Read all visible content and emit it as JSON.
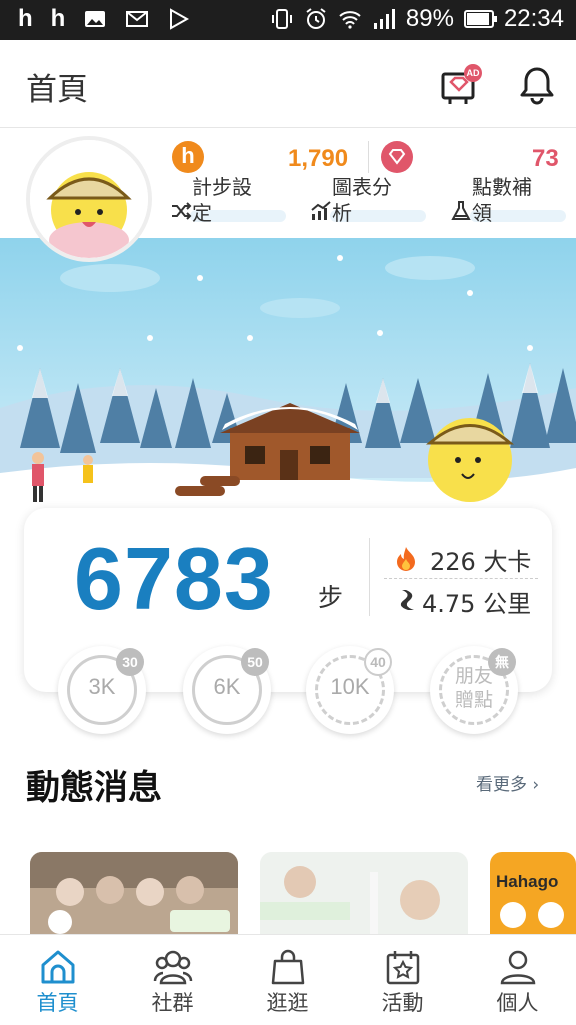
{
  "status_bar": {
    "battery": "89%",
    "time": "22:34"
  },
  "header": {
    "title": "首頁",
    "gift_badge": "AD"
  },
  "points": {
    "h_points": "1,790",
    "gem_points": "73"
  },
  "quick_actions": [
    {
      "label_line1": "計步設",
      "label_line2": "定",
      "icon": "shuffle-icon"
    },
    {
      "label_line1": "圖表分",
      "label_line2": "析",
      "icon": "chart-icon"
    },
    {
      "label_line1": "點數補",
      "label_line2": "領",
      "icon": "flask-icon"
    }
  ],
  "steps": {
    "value": "6783",
    "unit": "步",
    "calories": "226 大卡",
    "distance": "4.75 公里"
  },
  "milestones": [
    {
      "label": "3K",
      "badge": "30"
    },
    {
      "label": "6K",
      "badge": "50"
    },
    {
      "label": "10K",
      "badge": "40"
    },
    {
      "label_line1": "朋友",
      "label_line2": "贈點",
      "badge": "無"
    }
  ],
  "news": {
    "title": "動態消息",
    "more": "看更多",
    "card3_text": "Hahago"
  },
  "nav": [
    {
      "label": "首頁",
      "icon": "home-icon",
      "active": true
    },
    {
      "label": "社群",
      "icon": "community-icon",
      "active": false
    },
    {
      "label": "逛逛",
      "icon": "shopping-bag-icon",
      "active": false
    },
    {
      "label": "活動",
      "icon": "calendar-star-icon",
      "active": false
    },
    {
      "label": "個人",
      "icon": "person-icon",
      "active": false
    }
  ],
  "colors": {
    "accent_blue": "#1a7fc0",
    "orange": "#f08a1c",
    "pink": "#e0566a",
    "nav_active": "#1f8fce"
  }
}
